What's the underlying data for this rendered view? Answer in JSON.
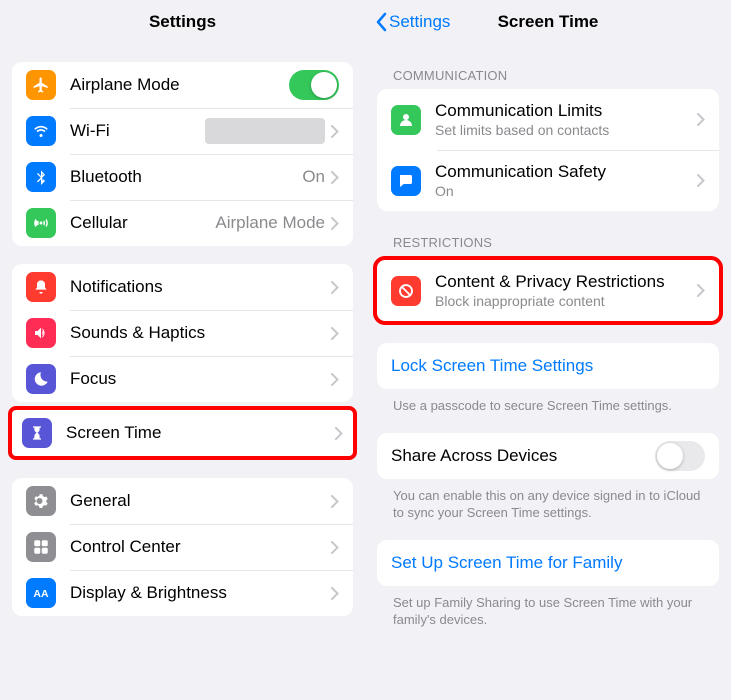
{
  "left": {
    "title": "Settings",
    "groups": [
      {
        "rows": [
          {
            "id": "airplane",
            "label": "Airplane Mode",
            "icon": "airplane",
            "iconBg": "#ff9500",
            "control": "switch",
            "switchOn": true
          },
          {
            "id": "wifi",
            "label": "Wi-Fi",
            "icon": "wifi",
            "iconBg": "#007aff",
            "control": "disclosure",
            "valueBlur": true
          },
          {
            "id": "bluetooth",
            "label": "Bluetooth",
            "icon": "bluetooth",
            "iconBg": "#007aff",
            "control": "disclosure",
            "value": "On"
          },
          {
            "id": "cellular",
            "label": "Cellular",
            "icon": "cellular",
            "iconBg": "#34c759",
            "control": "disclosure",
            "value": "Airplane Mode"
          }
        ]
      },
      {
        "rows": [
          {
            "id": "notifications",
            "label": "Notifications",
            "icon": "notifications",
            "iconBg": "#ff3b30",
            "control": "disclosure"
          },
          {
            "id": "sounds",
            "label": "Sounds & Haptics",
            "icon": "sounds",
            "iconBg": "#ff2d55",
            "control": "disclosure"
          },
          {
            "id": "focus",
            "label": "Focus",
            "icon": "focus",
            "iconBg": "#5856d6",
            "control": "disclosure"
          },
          {
            "id": "screentime",
            "label": "Screen Time",
            "icon": "screentime",
            "iconBg": "#5856d6",
            "control": "disclosure",
            "highlighted": true
          }
        ]
      },
      {
        "rows": [
          {
            "id": "general",
            "label": "General",
            "icon": "general",
            "iconBg": "#8e8e93",
            "control": "disclosure"
          },
          {
            "id": "controlcenter",
            "label": "Control Center",
            "icon": "controlcenter",
            "iconBg": "#8e8e93",
            "control": "disclosure"
          },
          {
            "id": "display",
            "label": "Display & Brightness",
            "icon": "display",
            "iconBg": "#007aff",
            "control": "disclosure"
          }
        ]
      }
    ]
  },
  "right": {
    "back": "Settings",
    "title": "Screen Time",
    "sections": [
      {
        "header": "COMMUNICATION",
        "rows": [
          {
            "id": "comm-limits",
            "label": "Communication Limits",
            "sub": "Set limits based on contacts",
            "icon": "comm-limits",
            "iconBg": "#34c759",
            "control": "disclosure"
          },
          {
            "id": "comm-safety",
            "label": "Communication Safety",
            "sub": "On",
            "icon": "comm-safety",
            "iconBg": "#007aff",
            "control": "disclosure"
          }
        ]
      },
      {
        "header": "RESTRICTIONS",
        "highlighted": true,
        "rows": [
          {
            "id": "restrictions",
            "label": "Content & Privacy Restrictions",
            "sub": "Block inappropriate content",
            "icon": "restrictions",
            "iconBg": "#ff3b30",
            "control": "disclosure"
          }
        ]
      },
      {
        "rows": [
          {
            "id": "lock",
            "linkLabel": "Lock Screen Time Settings",
            "control": "link"
          }
        ],
        "footer": "Use a passcode to secure Screen Time settings."
      },
      {
        "rows": [
          {
            "id": "share",
            "label": "Share Across Devices",
            "control": "switch",
            "switchOn": false
          }
        ],
        "footer": "You can enable this on any device signed in to iCloud to sync your Screen Time settings."
      },
      {
        "rows": [
          {
            "id": "family",
            "linkLabel": "Set Up Screen Time for Family",
            "control": "link"
          }
        ],
        "footer": "Set up Family Sharing to use Screen Time with your family's devices."
      }
    ]
  }
}
